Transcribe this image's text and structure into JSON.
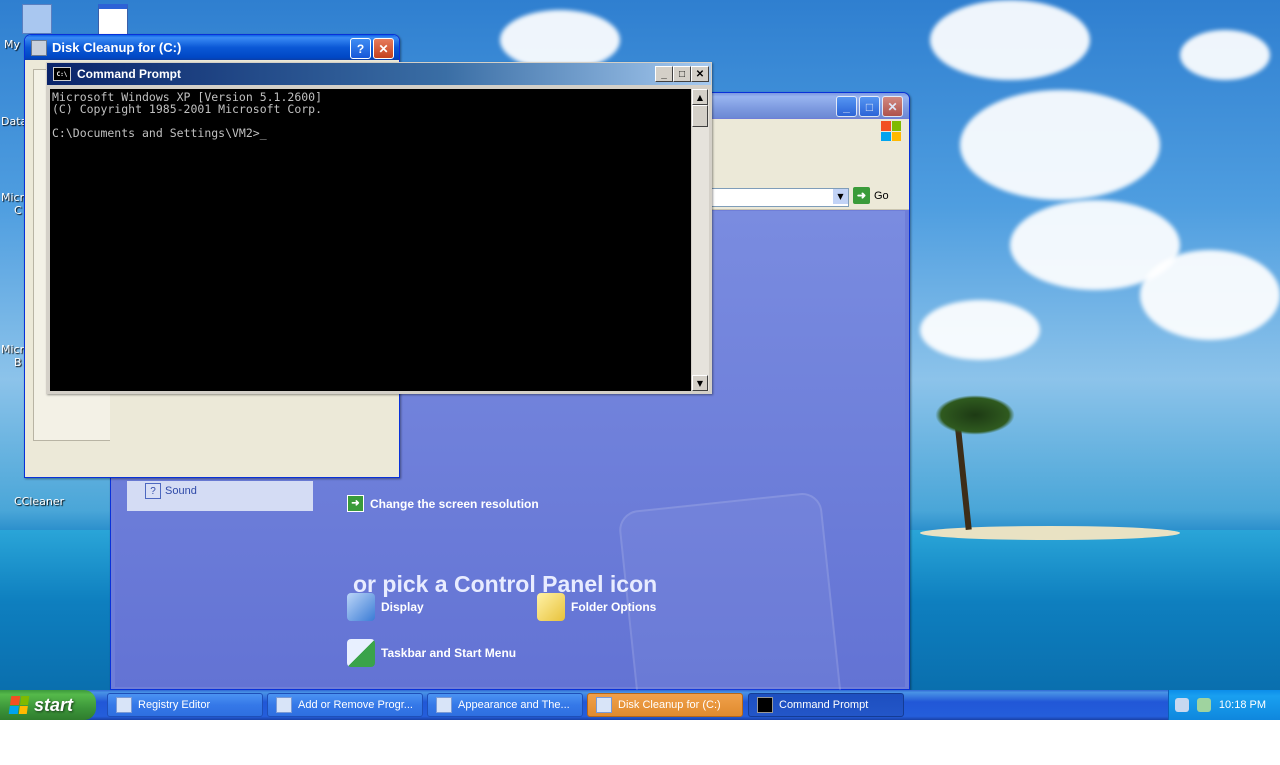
{
  "desktop": {
    "icons": [
      {
        "label": "My"
      },
      {
        "label": "Data"
      },
      {
        "label": "Micro"
      },
      {
        "label": "C"
      },
      {
        "label": "Micro"
      },
      {
        "label": "B"
      },
      {
        "label": "CCleaner"
      }
    ]
  },
  "disk_cleanup": {
    "title": "Disk Cleanup for  (C:)",
    "help": "?",
    "close": "✕"
  },
  "cmd": {
    "title": "Command Prompt",
    "icon_text": "C:\\",
    "lines": [
      "Microsoft Windows XP [Version 5.1.2600]",
      "(C) Copyright 1985-2001 Microsoft Corp.",
      "",
      "C:\\Documents and Settings\\VM2>_"
    ]
  },
  "control_panel": {
    "go_label": "Go",
    "side_item": "Sound",
    "task_link": "Change the screen resolution",
    "heading": "or pick a Control Panel icon",
    "icons": [
      {
        "label": "Display",
        "color": "#3a7bd5"
      },
      {
        "label": "Folder Options",
        "color": "#f2d24a"
      },
      {
        "label": "Taskbar and Start Menu",
        "color": "#3aa34a"
      }
    ]
  },
  "taskbar": {
    "start_label": "start",
    "tasks": [
      {
        "label": "Registry Editor",
        "state": "normal"
      },
      {
        "label": "Add or Remove Progr...",
        "state": "normal"
      },
      {
        "label": "Appearance and The...",
        "state": "normal"
      },
      {
        "label": "Disk Cleanup for  (C:)",
        "state": "active"
      },
      {
        "label": "Command Prompt",
        "state": "pressed"
      }
    ],
    "clock": "10:18 PM"
  },
  "colors": {
    "accent": "#0a58d6",
    "panel": "#6f7ed8",
    "start_green": "#3c963a"
  }
}
